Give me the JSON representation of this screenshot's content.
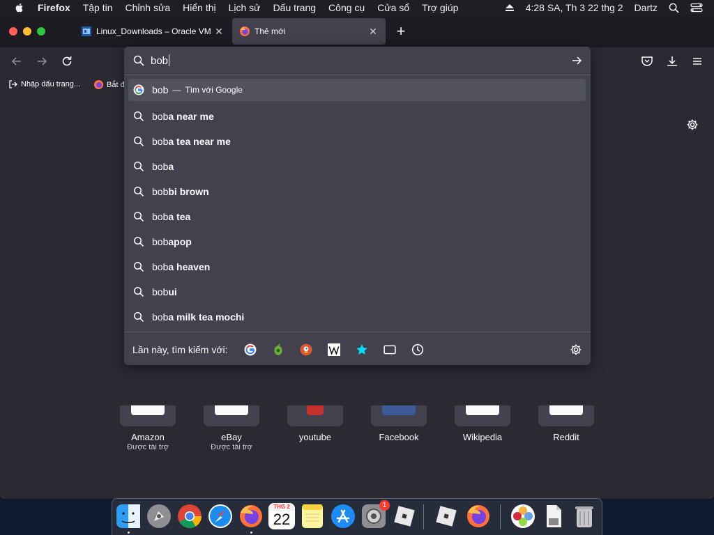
{
  "menubar": {
    "app": "Firefox",
    "items": [
      "Tập tin",
      "Chỉnh sửa",
      "Hiển thị",
      "Lịch sử",
      "Dấu trang",
      "Công cụ",
      "Cửa sổ",
      "Trợ giúp"
    ],
    "clock": "4:28 SA, Th 3 22 thg 2",
    "user": "Dartz"
  },
  "tabs": [
    {
      "title": "Linux_Downloads – Oracle VM V",
      "close": "✕"
    },
    {
      "title": "Thẻ mới",
      "close": "✕"
    }
  ],
  "newtab_symbol": "+",
  "bookmarks": {
    "import_label": "Nhập dấu trang...",
    "getting_started": "Bắt đ"
  },
  "urlbar": {
    "typed": "bob",
    "first_result": {
      "typed": "bob",
      "separator": "—",
      "action": "Tìm với Google"
    },
    "suggestions": [
      {
        "typed": "bob",
        "rest": "a near me"
      },
      {
        "typed": "bob",
        "rest": "a tea near me"
      },
      {
        "typed": "bob",
        "rest": "a"
      },
      {
        "typed": "bob",
        "rest": "bi brown"
      },
      {
        "typed": "bob",
        "rest": "a tea"
      },
      {
        "typed": "bob",
        "rest": "apop"
      },
      {
        "typed": "bob",
        "rest": "a heaven"
      },
      {
        "typed": "bob",
        "rest": "ui"
      },
      {
        "typed": "bob",
        "rest": "a milk tea mochi"
      }
    ],
    "oneoff_label": "Lần này, tìm kiếm với:"
  },
  "topsites": [
    {
      "label": "Amazon",
      "sub": "Được tài trợ"
    },
    {
      "label": "eBay",
      "sub": "Được tài trợ"
    },
    {
      "label": "youtube",
      "sub": ""
    },
    {
      "label": "Facebook",
      "sub": ""
    },
    {
      "label": "Wikipedia",
      "sub": ""
    },
    {
      "label": "Reddit",
      "sub": ""
    }
  ],
  "dock": {
    "calendar_month": "THG 2",
    "calendar_day": "22",
    "settings_badge": "1"
  },
  "colors": {
    "toolbar": "#2b2a33",
    "popup": "#42414d",
    "selected_row": "#52515e",
    "text": "#fbfbfe"
  }
}
